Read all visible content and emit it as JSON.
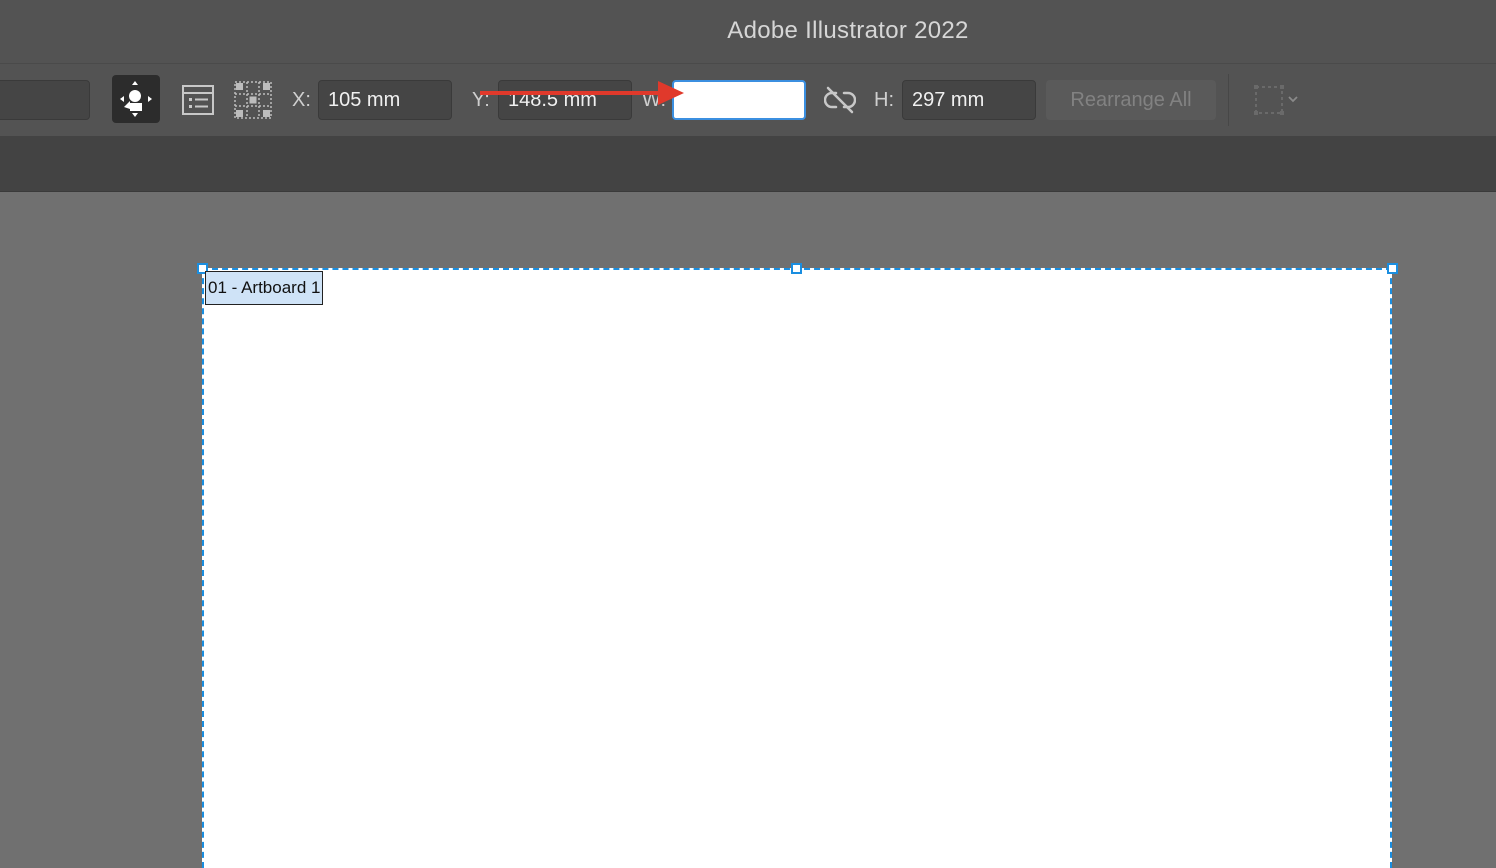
{
  "window": {
    "title": "Adobe Illustrator 2022"
  },
  "controlbar": {
    "x_label": "X:",
    "x_value": "105 mm",
    "y_label": "Y:",
    "y_value": "148.5 mm",
    "w_label": "W:",
    "w_value": "",
    "h_label": "H:",
    "h_value": "297 mm",
    "rearrange_label": "Rearrange All",
    "icons": {
      "move": "move-artboard-icon",
      "artboard_options": "artboard-options-icon",
      "reference_point": "reference-point-icon",
      "constrain": "unlink-proportions-icon",
      "align": "align-artboard-icon"
    }
  },
  "artboard": {
    "label": "01 - Artboard 1"
  },
  "annotation": {
    "arrow_color": "#e0392b"
  },
  "colors": {
    "accent": "#1a8ee0",
    "focus_field": "#3b8fe0"
  }
}
